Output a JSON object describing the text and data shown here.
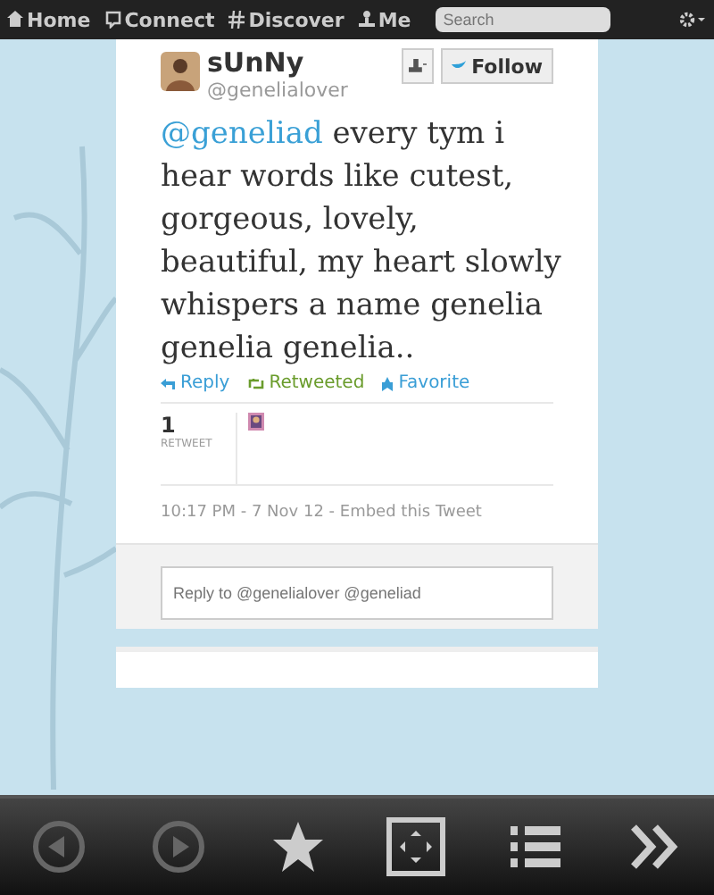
{
  "nav": {
    "items": [
      {
        "label": "Home",
        "kind": "home"
      },
      {
        "label": "Connect",
        "kind": "connect"
      },
      {
        "label": "Discover",
        "kind": "discover"
      },
      {
        "label": "Me",
        "kind": "me"
      }
    ],
    "search": {
      "placeholder": "Search"
    }
  },
  "tweet": {
    "name": "sUnNy",
    "handle": "@genelialover",
    "follow_label": "Follow",
    "mention": "@geneliad",
    "text": "every tym i hear words like cutest, gorgeous, lovely, beautiful, my heart slowly whispers a name genelia genelia genelia..",
    "actions": [
      {
        "label": "Reply",
        "kind": "reply",
        "on": false
      },
      {
        "label": "Retweeted",
        "kind": "retweet",
        "on": true
      },
      {
        "label": "Favorite",
        "kind": "favorite",
        "on": false
      }
    ],
    "stat": {
      "count": "1",
      "label": "RETWEET"
    },
    "meta": "10:17 PM - 7 Nov 12 - Embed this Tweet"
  },
  "reply": {
    "placeholder": "Reply to @genelialover @geneliad"
  },
  "toolbar": [
    {
      "kind": "back"
    },
    {
      "kind": "forward"
    },
    {
      "kind": "star"
    },
    {
      "kind": "fullscreen"
    },
    {
      "kind": "list"
    },
    {
      "kind": "more"
    }
  ]
}
